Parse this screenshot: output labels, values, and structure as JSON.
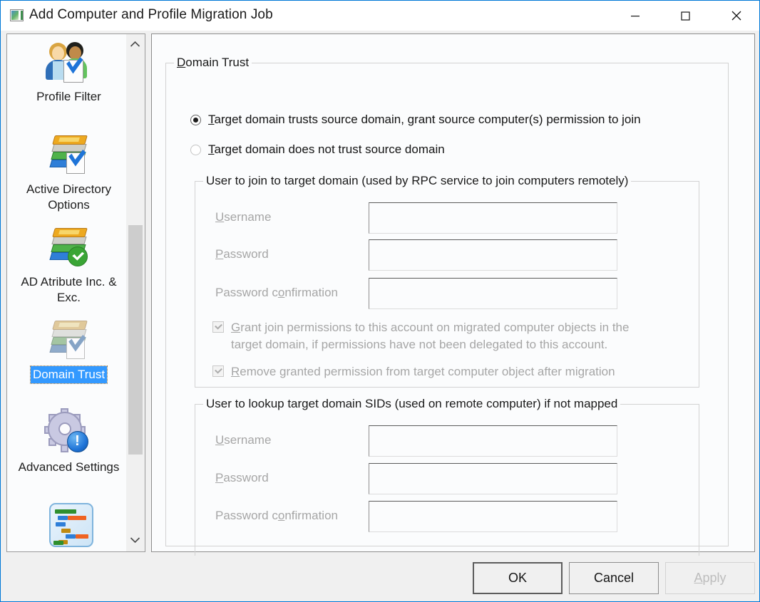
{
  "window": {
    "title": "Add Computer and Profile Migration Job",
    "icon": "monitor-icon",
    "controls": {
      "minimize": "minimize-icon",
      "maximize": "maximize-icon",
      "close": "close-icon"
    }
  },
  "sidebar": {
    "items": [
      {
        "label": "Profile Filter",
        "icon": "two-people-checklist-icon",
        "selected": false
      },
      {
        "label": "Active Directory Options",
        "icon": "books-stack-check-icon",
        "selected": false
      },
      {
        "label": "AD Atribute Inc. & Exc.",
        "icon": "books-stack-green-check-icon",
        "selected": false
      },
      {
        "label": "Domain Trust",
        "icon": "books-stack-faded-icon",
        "selected": true
      },
      {
        "label": "Advanced Settings",
        "icon": "gear-info-icon",
        "selected": false
      },
      {
        "label": "",
        "icon": "gantt-chart-icon",
        "selected": false
      }
    ],
    "scrollbar": {
      "up": "chevron-up-icon",
      "down": "chevron-down-icon"
    }
  },
  "panel": {
    "group_title": "Domain Trust",
    "radios": [
      {
        "label": "Target domain trusts source domain, grant source computer(s) permission to join",
        "accel": "T",
        "checked": true
      },
      {
        "label": "Target domain does not trust source domain",
        "accel": "T",
        "checked": false
      }
    ],
    "join_group": {
      "legend": "User to join to target domain (used by RPC service to join computers remotely)",
      "fields": [
        {
          "label": "Username",
          "accel": "U",
          "value": "",
          "type": "text"
        },
        {
          "label": "Password",
          "accel": "P",
          "value": "",
          "type": "password"
        },
        {
          "label": "Password confirmation",
          "accel": "o",
          "value": "",
          "type": "password"
        }
      ],
      "checkboxes": [
        {
          "label_line1": "Grant join permissions to this account on migrated computer objects in the",
          "label_line2": "target domain, if permissions have not been delegated to this account.",
          "accel": "G",
          "checked": true
        },
        {
          "label_line1": "Remove granted permission from target computer object after migration",
          "label_line2": "",
          "accel": "R",
          "checked": true
        }
      ]
    },
    "lookup_group": {
      "legend": "User to lookup target domain SIDs (used on remote computer) if not mapped",
      "fields": [
        {
          "label": "Username",
          "accel": "U",
          "value": "",
          "type": "text"
        },
        {
          "label": "Password",
          "accel": "P",
          "value": "",
          "type": "password"
        },
        {
          "label": "Password confirmation",
          "accel": "o",
          "value": "",
          "type": "password"
        }
      ]
    }
  },
  "footer": {
    "ok": "OK",
    "cancel": "Cancel",
    "apply": "Apply"
  },
  "colors": {
    "titlebar_border": "#0078d7",
    "selection": "#3399ff",
    "dialog_face": "#f0f0f0",
    "panel_face": "#fbfcfd",
    "disabled_text": "#a6a6a6"
  }
}
